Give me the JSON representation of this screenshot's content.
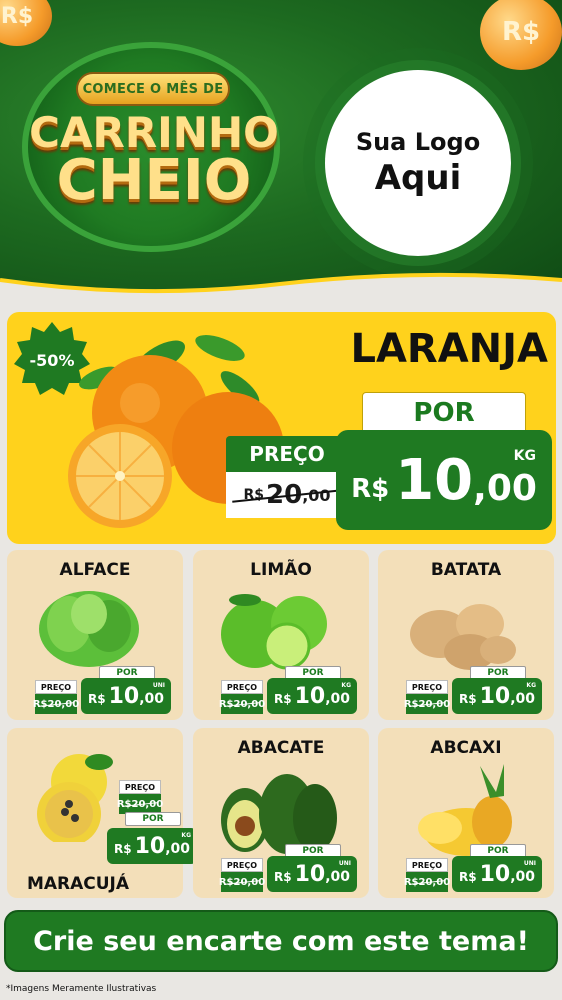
{
  "header": {
    "headline_small": "COMECE O MÊS DE",
    "headline_line1": "CARRINHO",
    "headline_line2": "CHEIO",
    "coin_text": "R$",
    "logo_line1": "Sua Logo",
    "logo_line2": "Aqui"
  },
  "feature": {
    "discount": "-50%",
    "name": "LARANJA",
    "por_label": "POR",
    "preco_label": "PREÇO",
    "old_currency": "R$",
    "old_price": "20",
    "old_cents": ",00",
    "currency": "R$",
    "price": "10",
    "cents": ",00",
    "unit": "KG"
  },
  "products": [
    {
      "name": "ALFACE",
      "por": "POR",
      "preco": "PREÇO",
      "old": "R$20,00",
      "currency": "R$",
      "price": "10",
      "cents": ",00",
      "unit": "UNI"
    },
    {
      "name": "LIMÃO",
      "por": "POR",
      "preco": "PREÇO",
      "old": "R$20,00",
      "currency": "R$",
      "price": "10",
      "cents": ",00",
      "unit": "KG"
    },
    {
      "name": "BATATA",
      "por": "POR",
      "preco": "PREÇO",
      "old": "R$20,00",
      "currency": "R$",
      "price": "10",
      "cents": ",00",
      "unit": "KG"
    },
    {
      "name": "MARACUJÁ",
      "por": "POR",
      "preco": "PREÇO",
      "old": "R$20,00",
      "currency": "R$",
      "price": "10",
      "cents": ",00",
      "unit": "KG"
    },
    {
      "name": "ABACATE",
      "por": "POR",
      "preco": "PREÇO",
      "old": "R$20,00",
      "currency": "R$",
      "price": "10",
      "cents": ",00",
      "unit": "UNI"
    },
    {
      "name": "ABCAXI",
      "por": "POR",
      "preco": "PREÇO",
      "old": "R$20,00",
      "currency": "R$",
      "price": "10",
      "cents": ",00",
      "unit": "UNI"
    }
  ],
  "cta": "Crie seu encarte com este tema!",
  "footer_note": "*Imagens Meramente Ilustrativas",
  "colors": {
    "brand_green": "#1f7a22",
    "feature_yellow": "#ffd21c",
    "card_beige": "#f3dfb9"
  }
}
